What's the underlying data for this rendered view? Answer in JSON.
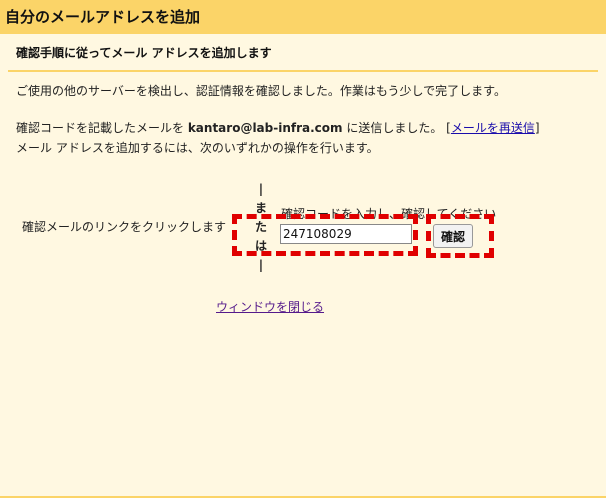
{
  "window": {
    "title": "自分のメールアドレスを追加"
  },
  "header": {
    "subtitle": "確認手順に従ってメール アドレスを追加します"
  },
  "messages": {
    "line1": "ご使用の他のサーバーを検出し、認証情報を確認しました。作業はもう少しで完了します。",
    "line2_prefix": "確認コードを記載したメールを ",
    "email": "kantaro@lab-infra.com",
    "line2_suffix": " に送信しました。 [",
    "resend_link": "メールを再送信",
    "line2_close": "]",
    "line3": "メール アドレスを追加するには、次のいずれかの操作を行います。"
  },
  "options": {
    "left_text": "確認メールのリンクをクリックします",
    "or_chars": [
      "|",
      "ま",
      "た",
      "は",
      "|"
    ],
    "right_label": "確認コードを入力し、確認してください",
    "code_value": "247108029",
    "confirm_button": "確認"
  },
  "footer": {
    "close_link": "ウィンドウを閉じる"
  },
  "colors": {
    "title_bar": "#fbd468",
    "background": "#fff8e1",
    "highlight": "#e00000"
  }
}
